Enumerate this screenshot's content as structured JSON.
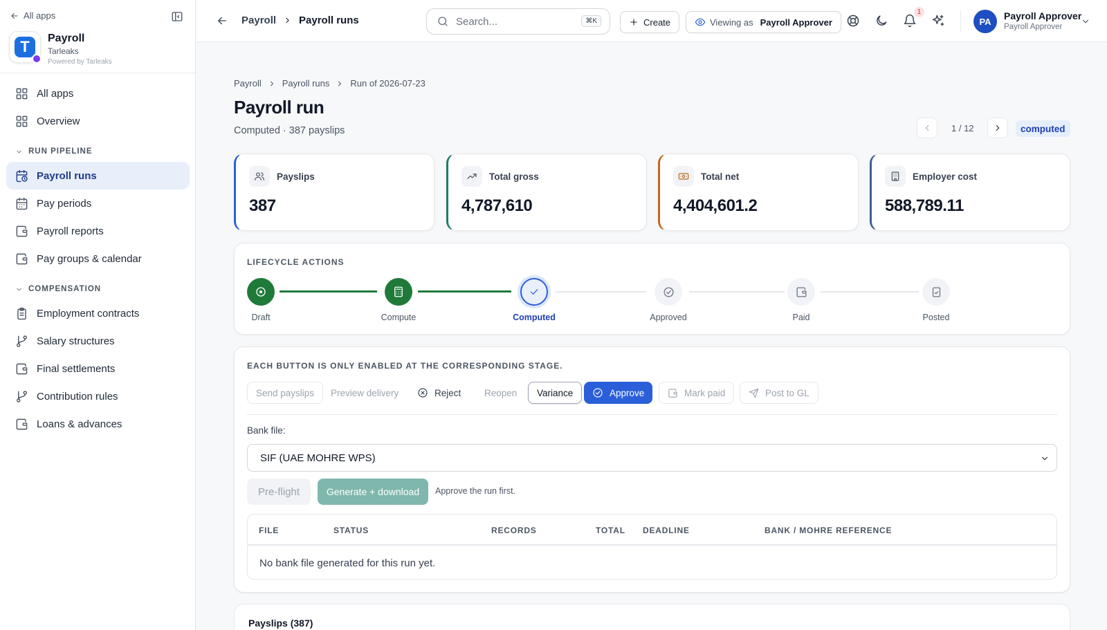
{
  "sidebar": {
    "back_label": "All apps",
    "app_name": "Payroll",
    "app_org": "Tarleaks",
    "app_powered": "Powered by Tarleaks",
    "app_logo_letter": "T",
    "nav_top": [
      {
        "label": "All apps",
        "icon": "grid-icon"
      },
      {
        "label": "Overview",
        "icon": "grid-icon"
      }
    ],
    "section_run": "RUN PIPELINE",
    "run_items": [
      {
        "label": "Payroll runs",
        "icon": "calendar-clock-icon",
        "active": true
      },
      {
        "label": "Pay periods",
        "icon": "calendar-icon"
      },
      {
        "label": "Payroll reports",
        "icon": "wallet-icon"
      },
      {
        "label": "Pay groups & calendar",
        "icon": "wallet-icon"
      }
    ],
    "section_comp": "COMPENSATION",
    "comp_items": [
      {
        "label": "Employment contracts",
        "icon": "clipboard-icon"
      },
      {
        "label": "Salary structures",
        "icon": "branch-icon"
      },
      {
        "label": "Final settlements",
        "icon": "wallet-icon"
      },
      {
        "label": "Contribution rules",
        "icon": "branch-icon"
      },
      {
        "label": "Loans & advances",
        "icon": "wallet-icon"
      }
    ]
  },
  "topbar": {
    "crumb_parent": "Payroll",
    "crumb_current": "Payroll runs",
    "search_placeholder": "Search...",
    "search_shortcut": "⌘K",
    "create_label": "Create",
    "viewing_prefix": "Viewing as",
    "viewing_role": "Payroll Approver",
    "notif_count": "1",
    "avatar_initials": "PA",
    "user_name": "Payroll Approver",
    "user_role": "Payroll Approver"
  },
  "page": {
    "breadcrumb": [
      "Payroll",
      "Payroll runs",
      "Run of 2026-07-23"
    ],
    "title": "Payroll run",
    "subtitle": "Computed · 387 payslips",
    "pager": "1 / 12",
    "status": "computed"
  },
  "kpis": [
    {
      "label": "Payslips",
      "value": "387",
      "accent": "#2b5fd9",
      "icon": "users-icon"
    },
    {
      "label": "Total gross",
      "value": "4,787,610",
      "accent": "#1f7a6a",
      "icon": "trending-up-icon"
    },
    {
      "label": "Total net",
      "value": "4,404,601.2",
      "accent": "#c2691b",
      "icon": "banknote-icon"
    },
    {
      "label": "Employer cost",
      "value": "588,789.11",
      "accent": "#3f5f8f",
      "icon": "building-icon"
    }
  ],
  "lifecycle": {
    "title": "LIFECYCLE ACTIONS",
    "steps": [
      {
        "label": "Draft",
        "state": "done",
        "icon": "circle-dot-icon"
      },
      {
        "label": "Compute",
        "state": "done",
        "icon": "calculator-icon"
      },
      {
        "label": "Computed",
        "state": "current",
        "icon": "check-icon"
      },
      {
        "label": "Approved",
        "state": "todo",
        "icon": "check-circle-icon"
      },
      {
        "label": "Paid",
        "state": "todo",
        "icon": "wallet-icon"
      },
      {
        "label": "Posted",
        "state": "todo",
        "icon": "file-check-icon"
      }
    ]
  },
  "actions": {
    "title": "EACH BUTTON IS ONLY ENABLED AT THE CORRESPONDING STAGE.",
    "send": "Send payslips",
    "preview": "Preview delivery",
    "reject": "Reject",
    "reopen": "Reopen",
    "variance": "Variance",
    "approve": "Approve",
    "mark_paid": "Mark paid",
    "post_gl": "Post to GL",
    "bank_label": "Bank file:",
    "bank_selected": "SIF (UAE MOHRE WPS)",
    "preflight": "Pre-flight",
    "generate": "Generate + download",
    "hint": "Approve the run first.",
    "table_columns": [
      "FILE",
      "STATUS",
      "RECORDS",
      "TOTAL",
      "DEADLINE",
      "BANK / MOHRE REFERENCE"
    ],
    "table_empty": "No bank file generated for this run yet."
  },
  "payslips_section": {
    "title": "Payslips (387)"
  }
}
